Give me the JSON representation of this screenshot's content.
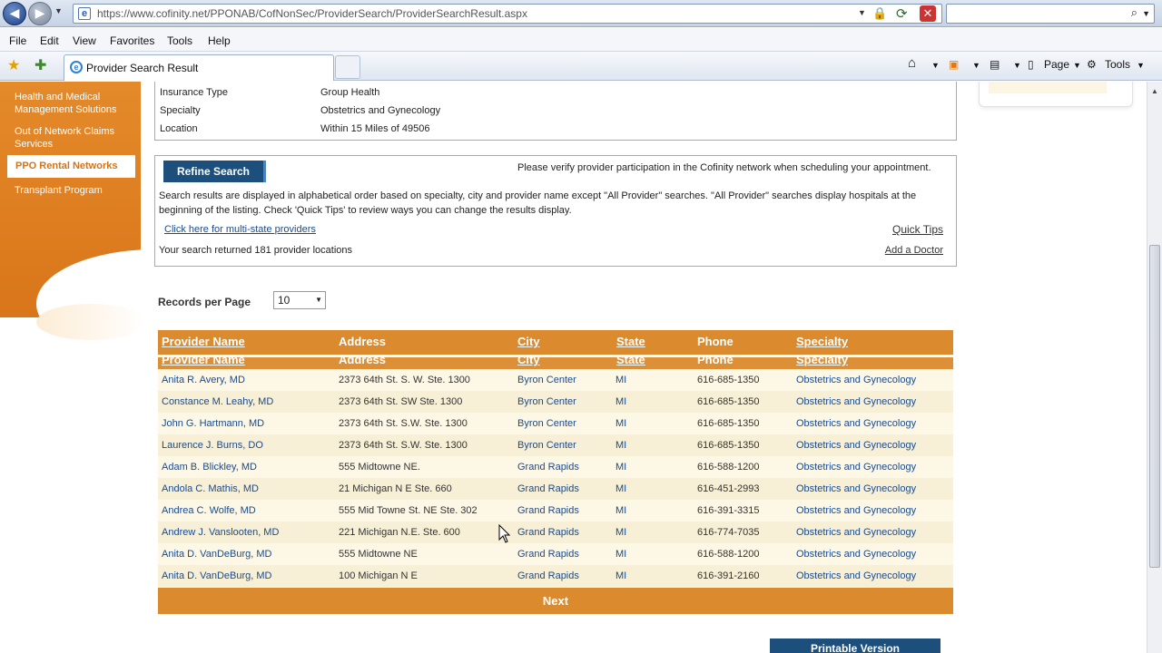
{
  "browser": {
    "url": "https://www.cofinity.net/PPONAB/CofNonSec/ProviderSearch/ProviderSearchResult.aspx",
    "search_placeholder": "",
    "menu": [
      "File",
      "Edit",
      "View",
      "Favorites",
      "Tools",
      "Help"
    ],
    "tab_title": "Provider Search Result",
    "toolbar": {
      "page_label": "Page",
      "tools_label": "Tools"
    }
  },
  "sidebar": {
    "items": [
      "Health and Medical Management Solutions",
      "Out of Network Claims Services",
      "PPO Rental Networks",
      "Transplant Program"
    ]
  },
  "criteria": [
    {
      "label": "Insurance Type",
      "value": "Group Health"
    },
    {
      "label": "Specialty",
      "value": "Obstetrics and Gynecology"
    },
    {
      "label": "Location",
      "value": "Within 15 Miles of 49506"
    }
  ],
  "info": {
    "refine_label": "Refine Search",
    "verify_text": "Please verify provider participation in the Cofinity network when scheduling your appointment.",
    "description": "Search results are displayed in alphabetical order based on specialty, city and provider name except \"All Provider\" searches. \"All Provider\" searches display hospitals at the beginning of the listing. Check 'Quick Tips' to review ways you can change the results display.",
    "multi_state_link": "Click here for multi-state providers",
    "quick_tips": "Quick Tips",
    "returned_text": "Your search returned 181 provider locations",
    "add_doctor": "Add a Doctor"
  },
  "records_per_page": {
    "label": "Records per Page",
    "value": "10"
  },
  "table": {
    "headers": [
      "Provider Name",
      "Address",
      "City",
      "State",
      "Phone",
      "Specialty"
    ],
    "rows": [
      [
        "Anita R. Avery, MD",
        "2373 64th St. S. W. Ste. 1300",
        "Byron Center",
        "MI",
        "616-685-1350",
        "Obstetrics and Gynecology"
      ],
      [
        "Constance M. Leahy, MD",
        "2373 64th St. SW Ste. 1300",
        "Byron Center",
        "MI",
        "616-685-1350",
        "Obstetrics and Gynecology"
      ],
      [
        "John G. Hartmann, MD",
        "2373 64th St. S.W. Ste. 1300",
        "Byron Center",
        "MI",
        "616-685-1350",
        "Obstetrics and Gynecology"
      ],
      [
        "Laurence J. Burns, DO",
        "2373 64th St. S.W. Ste. 1300",
        "Byron Center",
        "MI",
        "616-685-1350",
        "Obstetrics and Gynecology"
      ],
      [
        "Adam B. Blickley, MD",
        "555 Midtowne NE.",
        "Grand Rapids",
        "MI",
        "616-588-1200",
        "Obstetrics and Gynecology"
      ],
      [
        "Andola C. Mathis, MD",
        "21 Michigan N E Ste. 660",
        "Grand Rapids",
        "MI",
        "616-451-2993",
        "Obstetrics and Gynecology"
      ],
      [
        "Andrea C. Wolfe, MD",
        "555 Mid Towne St. NE Ste. 302",
        "Grand Rapids",
        "MI",
        "616-391-3315",
        "Obstetrics and Gynecology"
      ],
      [
        "Andrew J. Vanslooten, MD",
        "221 Michigan N.E. Ste. 600",
        "Grand Rapids",
        "MI",
        "616-774-7035",
        "Obstetrics and Gynecology"
      ],
      [
        "Anita D. VanDeBurg, MD",
        "555 Midtowne NE",
        "Grand Rapids",
        "MI",
        "616-588-1200",
        "Obstetrics and Gynecology"
      ],
      [
        "Anita D. VanDeBurg, MD",
        "100 Michigan N E",
        "Grand Rapids",
        "MI",
        "616-391-2160",
        "Obstetrics and Gynecology"
      ]
    ],
    "next_label": "Next"
  },
  "printable_label": "Printable Version",
  "colors": {
    "orange": "#dc8a2e",
    "navy": "#1d4f7d",
    "link": "#1a4b8c"
  }
}
